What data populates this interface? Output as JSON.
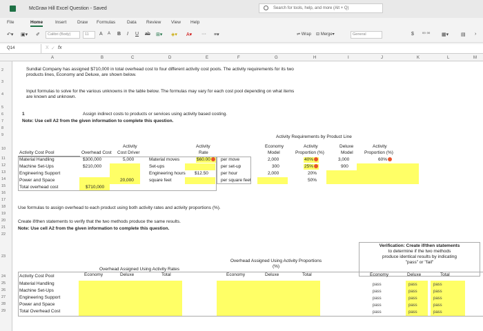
{
  "window": {
    "title": "McGraw Hill Excel Question - Saved",
    "search_placeholder": "Search for tools, help, and more (Alt + Q)"
  },
  "tabs": [
    "File",
    "Home",
    "Insert",
    "Draw",
    "Formulas",
    "Data",
    "Review",
    "View",
    "Help"
  ],
  "ribbon": {
    "font_name": "Calibri (Body)",
    "font_size": "11",
    "wrap_label": "Wrap",
    "merge_label": "Merge",
    "number_format": "General",
    "currency_symbol": "$",
    "bold": "B",
    "italic": "I",
    "underline": "U"
  },
  "formula_bar": {
    "name_box": "Q14",
    "fx": "fx",
    "x": "X",
    "check": "✓"
  },
  "columns": [
    "A",
    "B",
    "C",
    "D",
    "E",
    "F",
    "G",
    "H",
    "I",
    "J",
    "K",
    "L",
    "M"
  ],
  "rows": [
    "2",
    "3",
    "4",
    "5",
    "6",
    "7",
    "8",
    "9",
    "10",
    "11",
    "12",
    "13",
    "14",
    "15",
    "16",
    "17",
    "18",
    "19",
    "20",
    "21",
    "22",
    "23",
    "24",
    "25",
    "26",
    "27",
    "28",
    "29"
  ],
  "content": {
    "row2": "Sundial Company has assigned $710,000 in total overhead cost to four different activity cost pools. The activity requirements for its two",
    "row2b": "products lines, Economy and Deluxe, are shown below.",
    "row4": "Input formulas to solve for the various unknowns in the table below. The formulas may vary for each cost pool depending on what items",
    "row4b": "are known and unknown.",
    "row6_num": "1",
    "row6": "Assign indirect costs to products or services using activity based costing.",
    "row7": "Note: Use cell A2 from the given information to complete this question.",
    "req_header": "Activity Requirements by Product Line",
    "h_pool": "Activity Cost Pool",
    "h_activity": "Activity",
    "h_overhead": "Overhead Cost",
    "h_driver": "Cost Driver",
    "h_rate1": "Activity",
    "h_rate2": "Rate",
    "h_econ1": "Economy",
    "h_econ2": "Model",
    "h_aprop1": "Activity",
    "h_aprop2": "Proportion (%)",
    "h_dlx1": "Deluxe",
    "h_dlx2": "Model",
    "h_aprop3": "Activity",
    "h_aprop4": "Proportion (%)",
    "pools": [
      {
        "name": "Material Handling",
        "cost": "$300,000",
        "driver": "5,000",
        "driver_name": "Material moves",
        "rate": "$60.00",
        "unit": "per move",
        "econ": "2,000",
        "econ_prop": "40%",
        "dlx": "3,000",
        "dlx_prop": "60%"
      },
      {
        "name": "Machine Set-Ups",
        "cost": "$210,000",
        "driver": "",
        "driver_name": "Set-ups",
        "rate": "",
        "unit": "per set-up",
        "econ": "300",
        "econ_prop": "25%",
        "dlx": "900",
        "dlx_prop": ""
      },
      {
        "name": "Engineering Support",
        "cost": "",
        "driver": "",
        "driver_name": "Engineering hours",
        "rate": "$12.50",
        "unit": "per hour",
        "econ": "2,000",
        "econ_prop": "20%",
        "dlx": "",
        "dlx_prop": ""
      },
      {
        "name": "Power and Space",
        "cost": "",
        "driver": "20,000",
        "driver_name": "square feet",
        "rate": "",
        "unit": "per square feet",
        "econ": "",
        "econ_prop": "50%",
        "dlx": "",
        "dlx_prop": ""
      },
      {
        "name": "Total overhead cost",
        "cost": "$710,000",
        "driver": "",
        "driver_name": "",
        "rate": "",
        "unit": "",
        "econ": "",
        "econ_prop": "",
        "dlx": "",
        "dlx_prop": ""
      }
    ],
    "row17": "Use formulas to assign overhead to each product using both activity rates and activity proportions (%).",
    "row19": "Create if/then statements to verify that the two methods produce the same results.",
    "row20": "Note: Use cell A2 from the given information to complete this question.",
    "verif_title": "Verification: Create if/then statements",
    "verif_l2": "to determine if the two methods",
    "verif_l3": "produce identical results by indicating",
    "verif_l4": "\"pass\" or \"fail\"",
    "oar_title": "Overhead Assigned Using Activity Rates",
    "oap_title1": "Overhead Assigned Using Activity Proportions",
    "oap_title2": "(%)",
    "col_econ": "Economy",
    "col_dlx": "Deluxe",
    "col_total": "Total",
    "bottom_pools": [
      "Activity Cost Pool",
      "Material Handling",
      "Machine Set-Ups",
      "Engineering Support",
      "Power and Space",
      "Total Overhead Cost"
    ],
    "pass_word": "pass"
  },
  "colors": {
    "yellow": "#ffff66",
    "error": "#e8542c",
    "excel_green": "#1e7145"
  }
}
